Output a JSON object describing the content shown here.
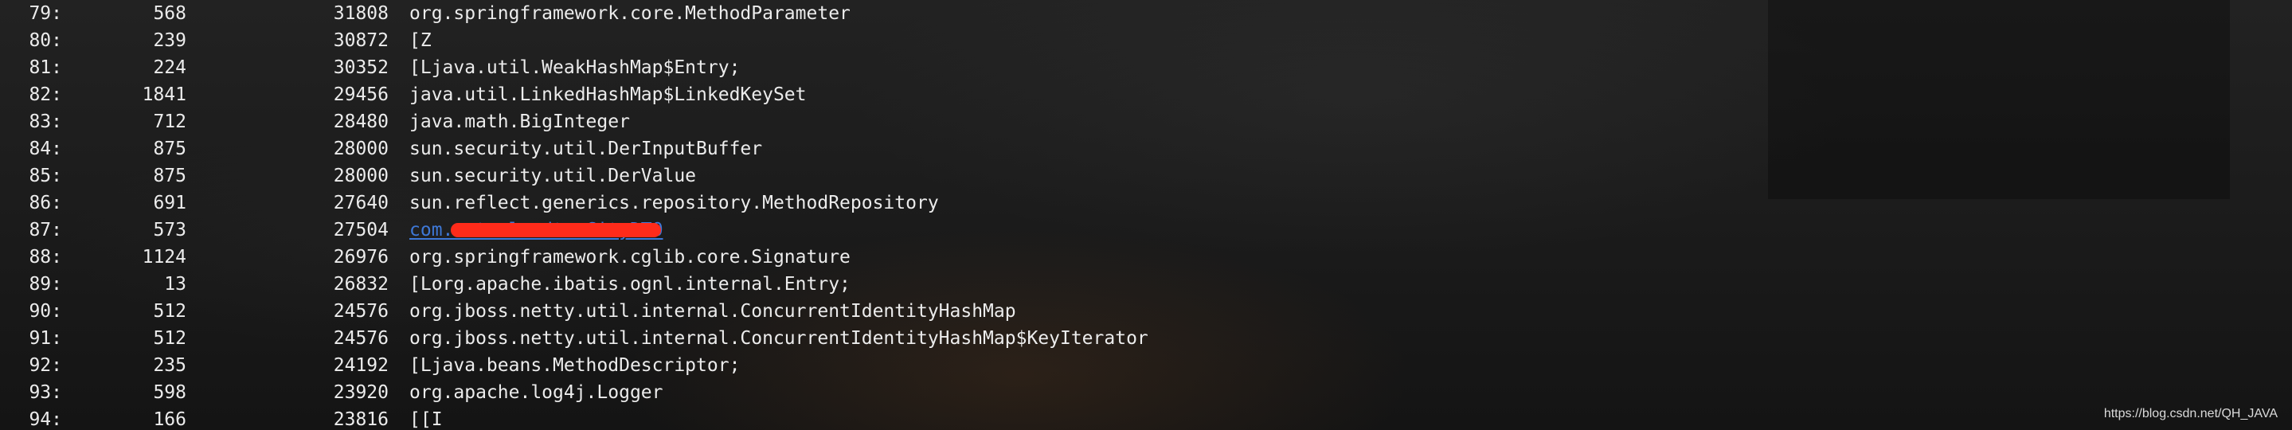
{
  "rows": [
    {
      "num": "79:",
      "instances": "568",
      "bytes": "31808",
      "class_name": "org.springframework.core.MethodParameter"
    },
    {
      "num": "80:",
      "instances": "239",
      "bytes": "30872",
      "class_name": "[Z"
    },
    {
      "num": "81:",
      "instances": "224",
      "bytes": "30352",
      "class_name": "[Ljava.util.WeakHashMap$Entry;"
    },
    {
      "num": "82:",
      "instances": "1841",
      "bytes": "29456",
      "class_name": "java.util.LinkedHashMap$LinkedKeySet"
    },
    {
      "num": "83:",
      "instances": "712",
      "bytes": "28480",
      "class_name": "java.math.BigInteger"
    },
    {
      "num": "84:",
      "instances": "875",
      "bytes": "28000",
      "class_name": "sun.security.util.DerInputBuffer"
    },
    {
      "num": "85:",
      "instances": "875",
      "bytes": "28000",
      "class_name": "sun.security.util.DerValue"
    },
    {
      "num": "86:",
      "instances": "691",
      "bytes": "27640",
      "class_name": "sun.reflect.generics.repository.MethodRepository"
    },
    {
      "num": "87:",
      "instances": "573",
      "bytes": "27504",
      "class_name": "com.                     .tools.dto.CityDTO"
    },
    {
      "num": "88:",
      "instances": "1124",
      "bytes": "26976",
      "class_name": "org.springframework.cglib.core.Signature"
    },
    {
      "num": "89:",
      "instances": "13",
      "bytes": "26832",
      "class_name": "[Lorg.apache.ibatis.ognl.internal.Entry;"
    },
    {
      "num": "90:",
      "instances": "512",
      "bytes": "24576",
      "class_name": "org.jboss.netty.util.internal.ConcurrentIdentityHashMap"
    },
    {
      "num": "91:",
      "instances": "512",
      "bytes": "24576",
      "class_name": "org.jboss.netty.util.internal.ConcurrentIdentityHashMap$KeyIterator"
    },
    {
      "num": "92:",
      "instances": "235",
      "bytes": "24192",
      "class_name": "[Ljava.beans.MethodDescriptor;"
    },
    {
      "num": "93:",
      "instances": "598",
      "bytes": "23920",
      "class_name": "org.apache.log4j.Logger"
    },
    {
      "num": "94:",
      "instances": "166",
      "bytes": "23816",
      "class_name": "[[I"
    }
  ],
  "watermark": "https://blog.csdn.net/QH_JAVA",
  "colors": {
    "text": "#ececec",
    "link": "#3e78d6",
    "redaction": "#ff2b1a"
  }
}
